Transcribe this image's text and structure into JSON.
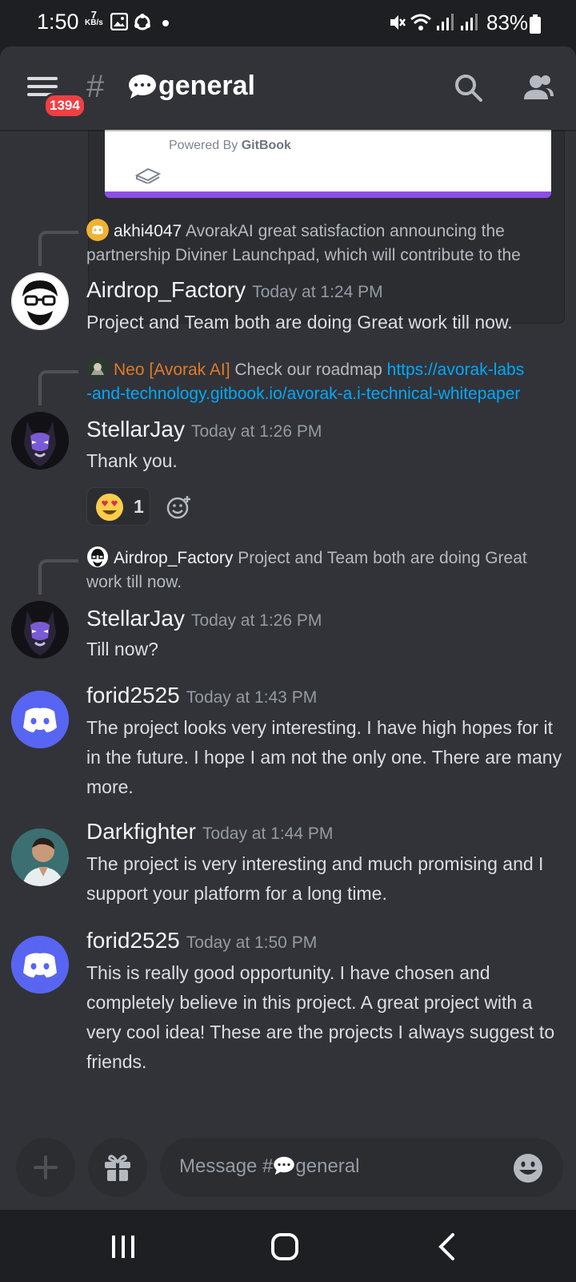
{
  "status_bar": {
    "time": "1:50",
    "net_speed": "7",
    "net_unit": "KB/s",
    "battery": "83%"
  },
  "header": {
    "badge_count": "1394",
    "hash": "#",
    "channel_name": "general"
  },
  "embed": {
    "powered_by": "Powered By",
    "brand": "GitBook"
  },
  "messages": [
    {
      "reply": {
        "username": "akhi4047",
        "text": "AvorakAI great satisfaction announcing the",
        "text2": "partnership Diviner Launchpad, which will contribute to the"
      },
      "username": "Airdrop_Factory",
      "timestamp": "Today at 1:24 PM",
      "text": "Project and Team both are doing Great work till now."
    },
    {
      "reply": {
        "username": "Neo [Avorak AI]",
        "text": "Check our roadmap",
        "link1": "https://avorak-labs",
        "link2": "-and-technology.gitbook.io/avorak-a.i-technical-whitepaper"
      },
      "username": "StellarJay",
      "timestamp": "Today at 1:26 PM",
      "text": "Thank you.",
      "reaction": {
        "emoji": "heart-eyes",
        "count": "1"
      }
    },
    {
      "reply": {
        "username": "Airdrop_Factory",
        "text": "Project and Team both are doing Great",
        "text2": "work till now."
      },
      "username": "StellarJay",
      "timestamp": "Today at 1:26 PM",
      "text": "Till now?"
    },
    {
      "username": "forid2525",
      "timestamp": "Today at 1:43 PM",
      "text": "The project looks very interesting. I have high hopes for it in the future. I hope I am not the only one. There are many more."
    },
    {
      "username": "Darkfighter",
      "timestamp": "Today at 1:44 PM",
      "text": "The project is very interesting and much promising and I support your platform for a long time."
    },
    {
      "username": "forid2525",
      "timestamp": "Today at 1:50 PM",
      "text": "This is really good opportunity. I have chosen and completely believe in this project. A great project with a very cool idea! These are the projects I always suggest to friends."
    }
  ],
  "composer": {
    "placeholder_prefix": "Message #",
    "placeholder_channel": "general"
  },
  "colors": {
    "accent": "#5865f2",
    "background": "#313338",
    "link": "#00a8fc",
    "badge": "#f23f43"
  }
}
